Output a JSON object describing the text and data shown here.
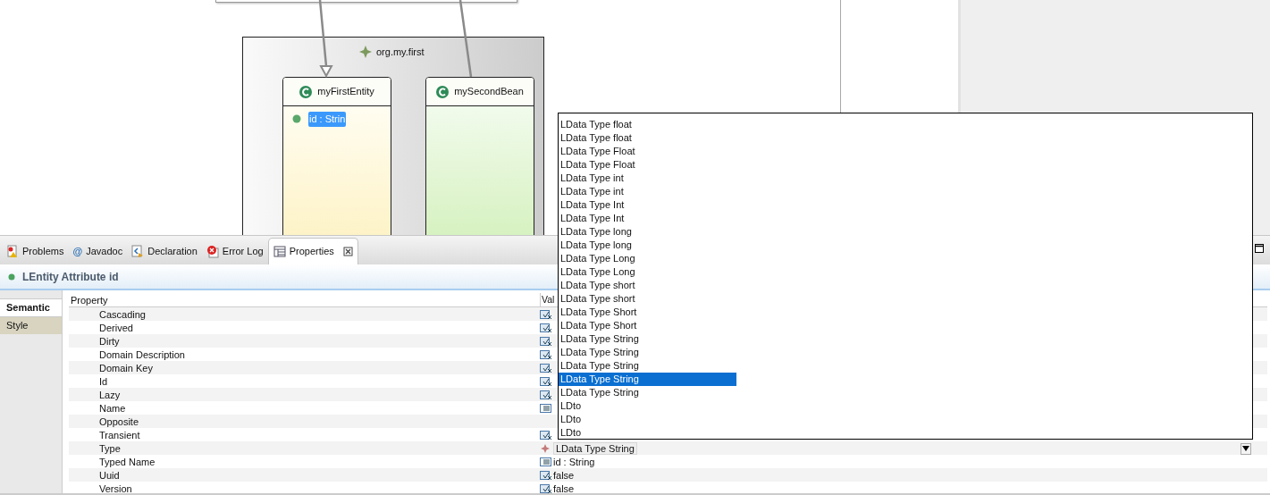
{
  "diagram": {
    "package": {
      "label": "org.my.first",
      "entities": [
        {
          "name": "myFirstEntity",
          "kind": "entity",
          "attributes": [
            {
              "label": "id : Strin",
              "selected": true
            }
          ]
        },
        {
          "name": "mySecondBean",
          "kind": "bean"
        }
      ]
    }
  },
  "tabs": [
    {
      "label": "Problems",
      "kind": "problems",
      "selected": false
    },
    {
      "label": "Javadoc",
      "kind": "javadoc",
      "symbol": "@",
      "selected": false
    },
    {
      "label": "Declaration",
      "kind": "declaration",
      "selected": false
    },
    {
      "label": "Error Log",
      "kind": "errorlog",
      "selected": false
    },
    {
      "label": "Properties",
      "kind": "properties",
      "selected": true,
      "closable": true
    }
  ],
  "header": {
    "title": "LEntity Attribute id"
  },
  "side_tabs": [
    {
      "label": "Semantic",
      "selected": true
    },
    {
      "label": "Style",
      "selected": false
    }
  ],
  "table": {
    "columns": [
      "Property",
      "Val"
    ],
    "rows": [
      {
        "property": "Cascading",
        "kind": "bool"
      },
      {
        "property": "Derived",
        "kind": "bool"
      },
      {
        "property": "Dirty",
        "kind": "bool"
      },
      {
        "property": "Domain Description",
        "kind": "bool"
      },
      {
        "property": "Domain Key",
        "kind": "bool"
      },
      {
        "property": "Id",
        "kind": "bool"
      },
      {
        "property": "Lazy",
        "kind": "bool"
      },
      {
        "property": "Name",
        "kind": "text"
      },
      {
        "property": "Opposite",
        "kind": "none"
      },
      {
        "property": "Transient",
        "kind": "bool"
      },
      {
        "property": "Type",
        "kind": "combo",
        "value": "LData Type String"
      },
      {
        "property": "Typed Name",
        "kind": "text",
        "value": "id : String"
      },
      {
        "property": "Uuid",
        "kind": "bool",
        "value": "false"
      },
      {
        "property": "Version",
        "kind": "bool",
        "value": "false"
      }
    ]
  },
  "popup": {
    "items": [
      {
        "label": "LData Type float",
        "selected": false
      },
      {
        "label": "LData Type float",
        "selected": false
      },
      {
        "label": "LData Type Float",
        "selected": false
      },
      {
        "label": "LData Type Float",
        "selected": false
      },
      {
        "label": "LData Type int",
        "selected": false
      },
      {
        "label": "LData Type int",
        "selected": false
      },
      {
        "label": "LData Type Int",
        "selected": false
      },
      {
        "label": "LData Type Int",
        "selected": false
      },
      {
        "label": "LData Type long",
        "selected": false
      },
      {
        "label": "LData Type long",
        "selected": false
      },
      {
        "label": "LData Type Long",
        "selected": false
      },
      {
        "label": "LData Type Long",
        "selected": false
      },
      {
        "label": "LData Type short",
        "selected": false
      },
      {
        "label": "LData Type short",
        "selected": false
      },
      {
        "label": "LData Type Short",
        "selected": false
      },
      {
        "label": "LData Type Short",
        "selected": false
      },
      {
        "label": "LData Type String",
        "selected": false
      },
      {
        "label": "LData Type String",
        "selected": false
      },
      {
        "label": "LData Type String",
        "selected": false
      },
      {
        "label": "LData Type String",
        "selected": true
      },
      {
        "label": "LData Type String",
        "selected": false
      },
      {
        "label": "LDto",
        "selected": false
      },
      {
        "label": "LDto",
        "selected": false
      },
      {
        "label": "LDto",
        "selected": false
      }
    ]
  }
}
